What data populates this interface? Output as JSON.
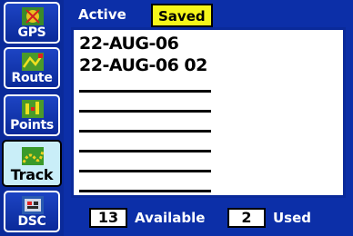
{
  "sidebar": {
    "items": [
      {
        "label": "GPS",
        "icon": "gps-icon"
      },
      {
        "label": "Route",
        "icon": "route-icon"
      },
      {
        "label": "Points",
        "icon": "points-icon"
      },
      {
        "label": "Track",
        "icon": "track-icon",
        "selected": true
      },
      {
        "label": "DSC",
        "icon": "dsc-icon"
      }
    ]
  },
  "tabs": {
    "active": "Active",
    "saved": "Saved"
  },
  "list": {
    "items": [
      "22-AUG-06",
      "22-AUG-06 02"
    ],
    "empty_slots": 6
  },
  "footer": {
    "available_count": "13",
    "available_label": "Available",
    "used_count": "2",
    "used_label": "Used"
  },
  "colors": {
    "background": "#0c2fa8",
    "selected_tab": "#f5f51a",
    "selected_sidebar": "#c9eef8"
  }
}
